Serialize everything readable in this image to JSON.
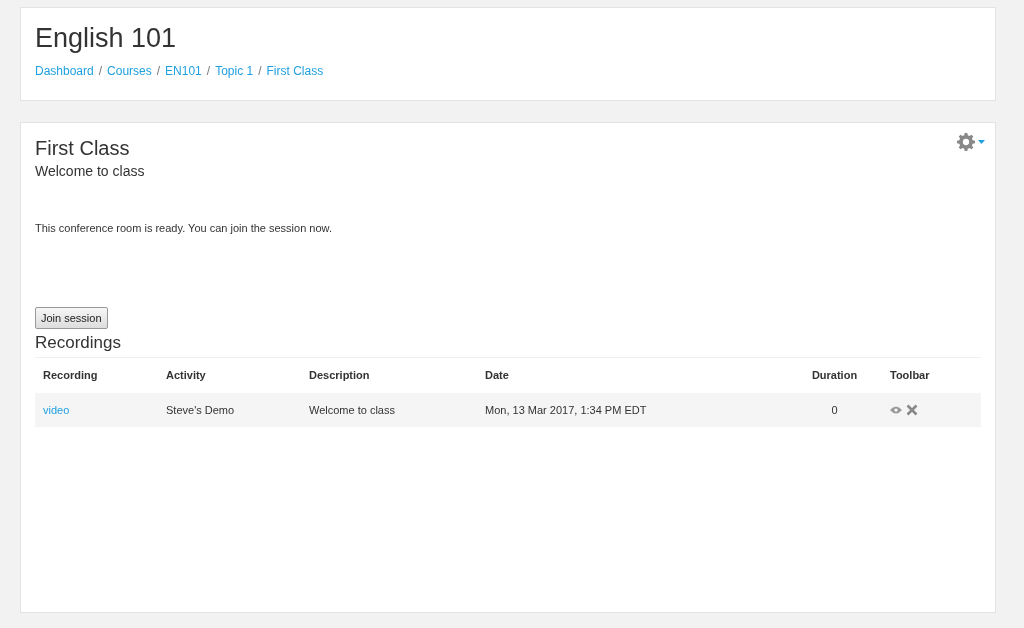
{
  "header": {
    "title": "English 101",
    "breadcrumb_separator": "/",
    "breadcrumbs": [
      {
        "label": "Dashboard"
      },
      {
        "label": "Courses"
      },
      {
        "label": "EN101"
      },
      {
        "label": "Topic 1"
      },
      {
        "label": "First Class"
      }
    ]
  },
  "activity": {
    "title": "First Class",
    "subtitle": "Welcome to class",
    "status": "This conference room is ready. You can join the session now.",
    "join_button": "Join session"
  },
  "recordings": {
    "title": "Recordings",
    "columns": [
      {
        "label": "Recording"
      },
      {
        "label": "Activity"
      },
      {
        "label": "Description"
      },
      {
        "label": "Date"
      },
      {
        "label": "Duration"
      },
      {
        "label": "Toolbar"
      }
    ],
    "rows": [
      {
        "recording": "video",
        "activity": "Steve's Demo",
        "description": "Welcome to class",
        "date": "Mon, 13 Mar 2017, 1:34 PM EDT",
        "duration": "0"
      }
    ]
  }
}
